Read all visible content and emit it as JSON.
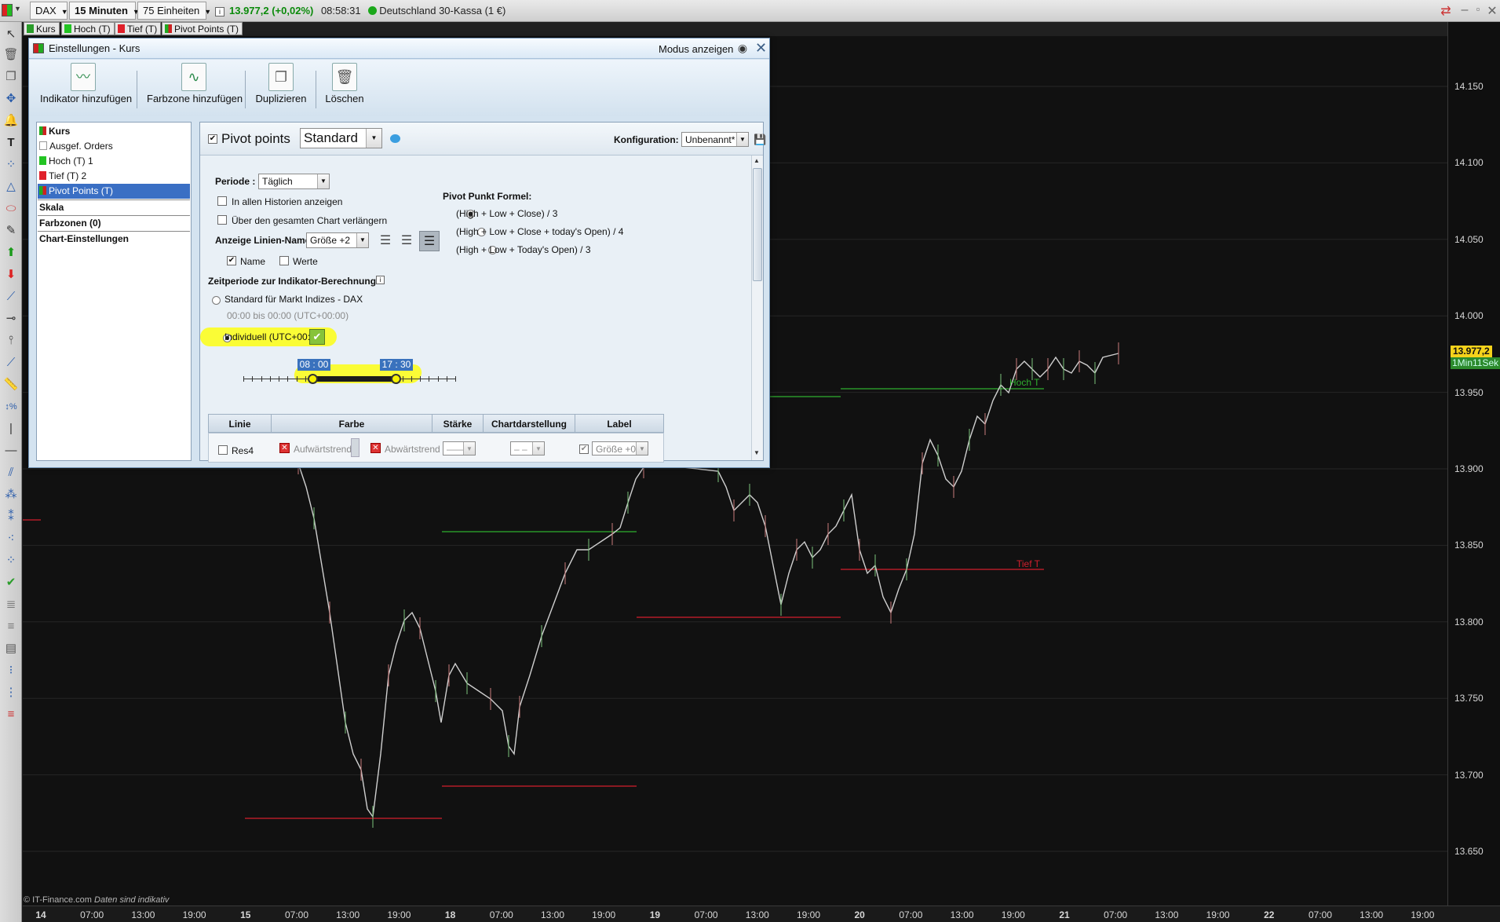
{
  "topbar": {
    "instrument": "DAX",
    "timeframe": "15 Minuten",
    "units": "75 Einheiten",
    "price": "13.977,2 (+0,02%)",
    "time": "08:58:31",
    "market": "Deutschland 30-Kassa (1 €)"
  },
  "indicator_tabs": [
    {
      "label": "Kurs",
      "color": "#2a9d2a"
    },
    {
      "label": "Hoch (T)",
      "color": "#23c423"
    },
    {
      "label": "Tief (T)",
      "color": "#e0202a"
    },
    {
      "label": "Pivot Points (T)",
      "color": "#cc2222"
    }
  ],
  "chart": {
    "y_ticks": [
      "14.150",
      "14.100",
      "14.050",
      "14.000",
      "13.950",
      "13.900",
      "13.850",
      "13.800",
      "13.750",
      "13.700",
      "13.650"
    ],
    "x_ticks": [
      {
        "label": "14",
        "day": true
      },
      {
        "label": "07:00"
      },
      {
        "label": "13:00"
      },
      {
        "label": "19:00"
      },
      {
        "label": "15",
        "day": true
      },
      {
        "label": "07:00"
      },
      {
        "label": "13:00"
      },
      {
        "label": "19:00"
      },
      {
        "label": "18",
        "day": true
      },
      {
        "label": "07:00"
      },
      {
        "label": "13:00"
      },
      {
        "label": "19:00"
      },
      {
        "label": "19",
        "day": true
      },
      {
        "label": "07:00"
      },
      {
        "label": "13:00"
      },
      {
        "label": "19:00"
      },
      {
        "label": "20",
        "day": true
      },
      {
        "label": "07:00"
      },
      {
        "label": "13:00"
      },
      {
        "label": "19:00"
      },
      {
        "label": "21",
        "day": true
      },
      {
        "label": "07:00"
      },
      {
        "label": "13:00"
      },
      {
        "label": "19:00"
      },
      {
        "label": "22",
        "day": true
      },
      {
        "label": "07:00"
      },
      {
        "label": "13:00"
      },
      {
        "label": "19:00"
      }
    ],
    "current_price": "13.977,2",
    "countdown": "1Min11Sek",
    "hoch_label": "Hoch T",
    "tief_label": "Tief T",
    "copyright": "© IT-Finance.com",
    "copyright_note": "Daten sind indikativ",
    "colors": {
      "high": "#2faf2f",
      "low": "#d21f2d",
      "candle_up": "#d8d8d8",
      "candle_down": "#d8d8d8"
    }
  },
  "dialog": {
    "title": "Einstellungen - Kurs",
    "mode": "Modus anzeigen",
    "toolbar": [
      "Indikator hinzufügen",
      "Farbzone hinzufügen",
      "Duplizieren",
      "Löschen"
    ],
    "tree": {
      "kurs": "Kurs",
      "orders": "Ausgef. Orders",
      "hoch": "Hoch (T) 1",
      "tief": "Tief (T) 2",
      "pivot": "Pivot Points (T)",
      "skala": "Skala",
      "farbzonen": "Farbzonen (0)",
      "chart_settings": "Chart-Einstellungen"
    },
    "panel": {
      "indicator_name": "Pivot points",
      "indicator_type": "Standard",
      "config_label": "Konfiguration:",
      "config_value": "Unbenannt*",
      "period_label": "Periode :",
      "period_value": "Täglich",
      "show_all_hist": "In allen Historien anzeigen",
      "extend_chart": "Über den gesamten Chart verlängern",
      "line_name_label": "Anzeige Linien-Name",
      "line_name_size": "Größe +2",
      "name_cb": "Name",
      "values_cb": "Werte",
      "formula_title": "Pivot Punkt Formel:",
      "formulas": [
        "(High + Low + Close) / 3",
        "(High + Low + Close + today's Open) / 4",
        "(High + Low + Today's Open) / 3"
      ],
      "timeframe_title": "Zeitperiode zur Indikator-Berechnung:",
      "std_option": "Standard für Markt Indizes - DAX",
      "std_range": "00:00 bis 00:00 (UTC+00:00)",
      "indiv_option": "Individuell (UTC+00:00)",
      "slider_start": "08 : 00",
      "slider_end": "17 : 30",
      "table_headers": [
        "Linie",
        "Farbe",
        "Stärke",
        "Chartdarstellung",
        "Label"
      ],
      "row": {
        "line": "Res4",
        "up": "Aufwärtstrend",
        "down": "Abwärtstrend",
        "label": "Größe +0"
      }
    }
  }
}
